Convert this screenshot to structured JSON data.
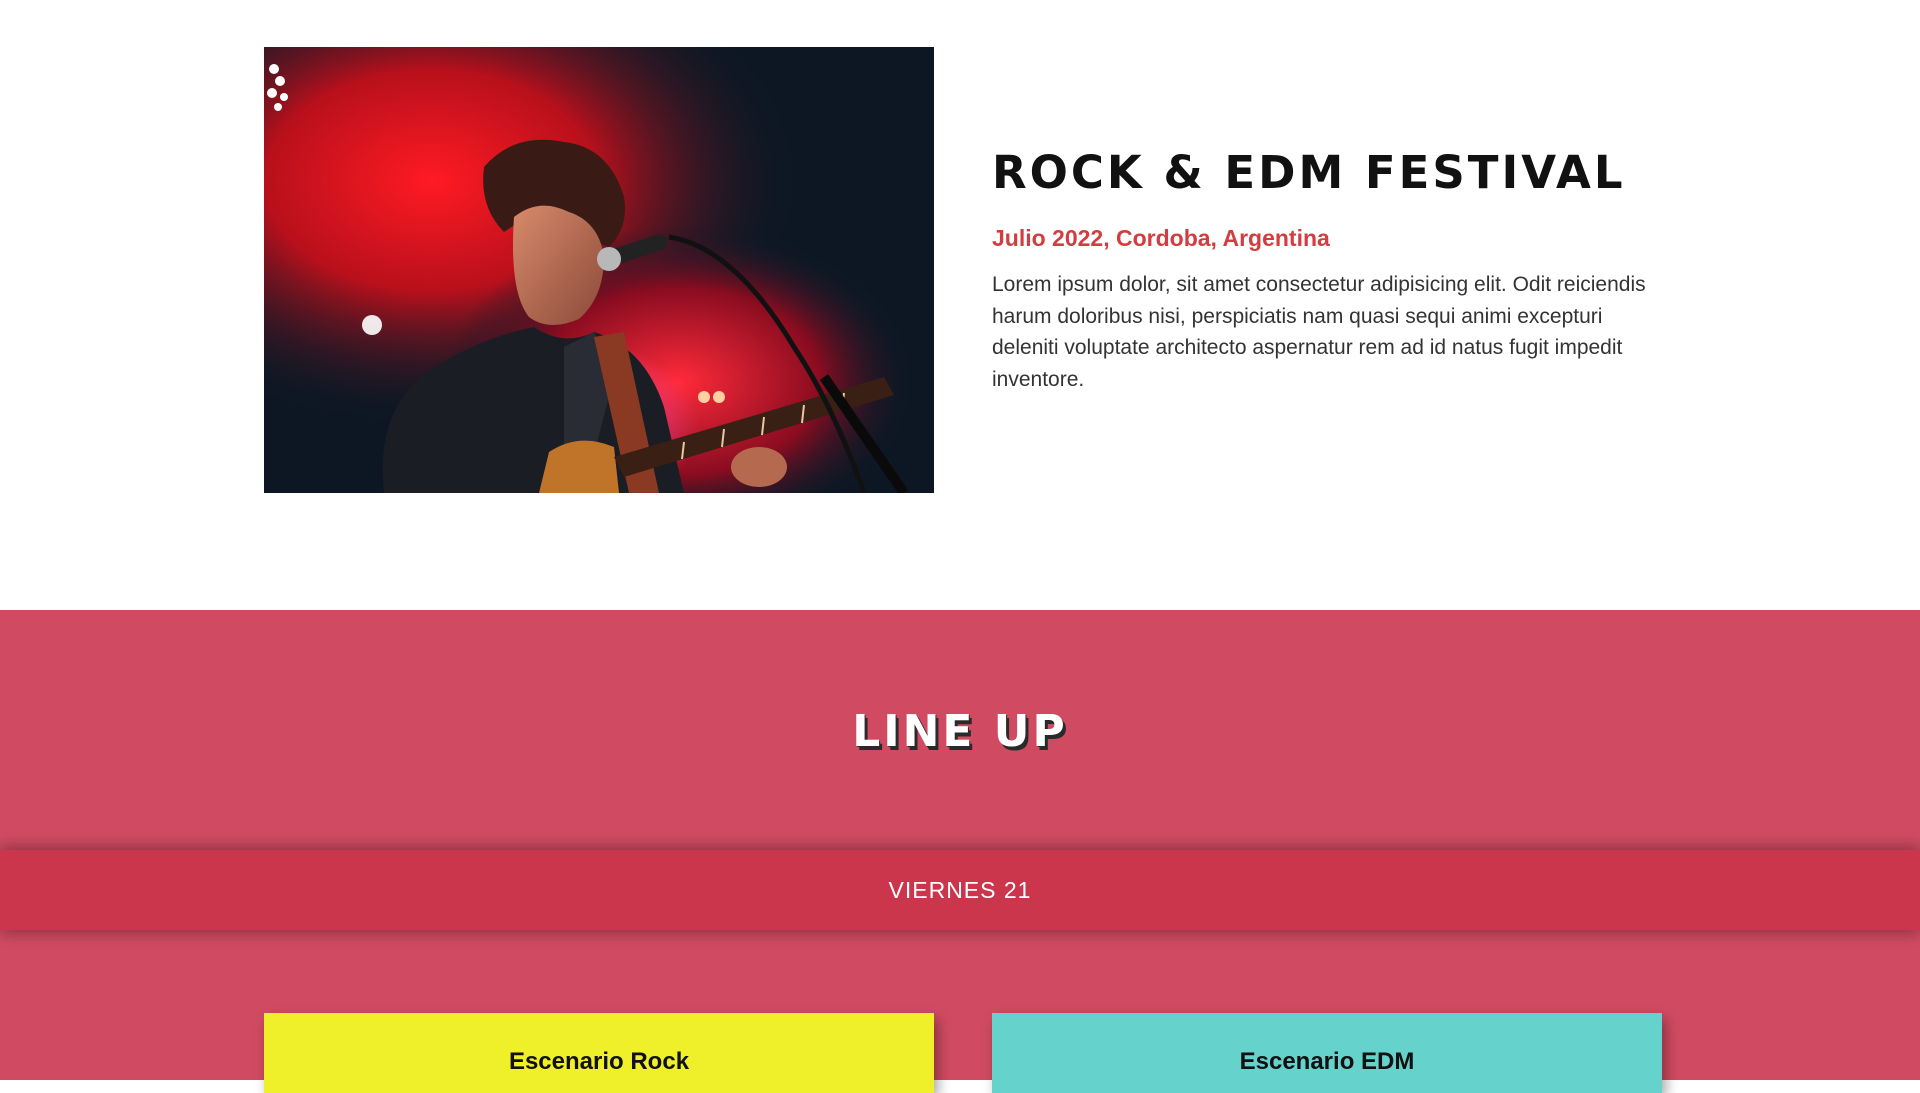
{
  "about": {
    "title": "Rock & EDM Festival",
    "subtitle": "Julio 2022, Cordoba, Argentina",
    "description": "Lorem ipsum dolor, sit amet consectetur adipisicing elit. Odit reiciendis harum doloribus nisi, perspiciatis nam quasi sequi animi excepturi deleniti voluptate architecto aspernatur rem ad id natus fugit impedit inventore."
  },
  "lineup": {
    "title": "Line Up",
    "day": "VIERNES 21",
    "stages": [
      {
        "label": "Escenario Rock"
      },
      {
        "label": "Escenario EDM"
      }
    ]
  },
  "colors": {
    "accent_red": "#d43d3f",
    "lineup_bg": "#d04b61",
    "day_bar_bg": "#cb364d",
    "stage_rock_bg": "#f0f02a",
    "stage_edm_bg": "#66d2cc"
  }
}
